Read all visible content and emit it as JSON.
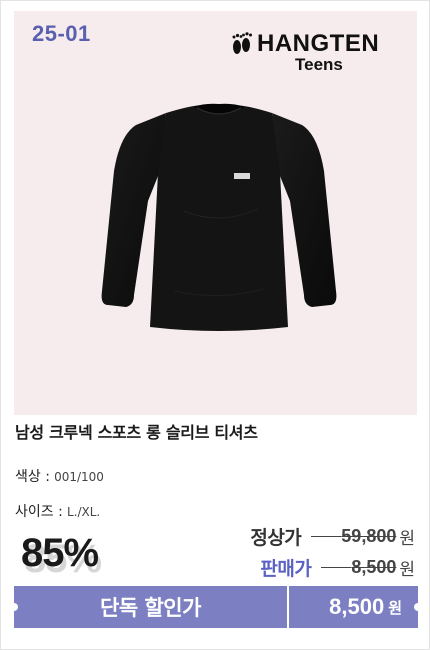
{
  "image": {
    "code": "25-01",
    "brand": {
      "name": "HANGTEN",
      "sub": "Teens",
      "icon": "footprints-logo-icon"
    },
    "product_photo": "black-long-sleeve-tshirt"
  },
  "product": {
    "title": "남성 크루넥 스포츠 롱 슬리브 티셔츠",
    "color_key": "색상 :",
    "color_value": "001/100",
    "size_key": "사이즈 :",
    "size_value": "L./XL."
  },
  "pricing": {
    "discount": "85%",
    "regular_label": "정상가",
    "regular_amount": "59,800",
    "regular_unit": "원",
    "sale_label": "판매가",
    "sale_amount": "8,500",
    "sale_unit": "원"
  },
  "promo": {
    "label": "단독 할인가",
    "price": "8,500",
    "unit": "원"
  },
  "colors": {
    "accent": "#7c80c2",
    "code": "#5a5fae",
    "sale_label": "#5b62c4",
    "panel_bg": "#f6ecee"
  }
}
